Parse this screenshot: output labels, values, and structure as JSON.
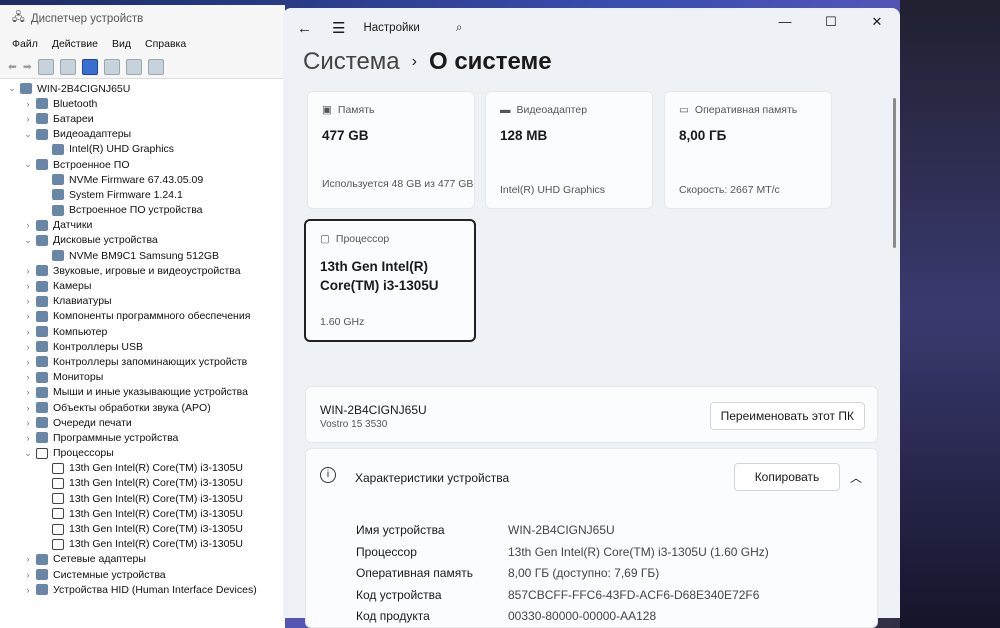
{
  "device_manager": {
    "title": "Диспетчер устройств",
    "menu": [
      "Файл",
      "Действие",
      "Вид",
      "Справка"
    ],
    "tree": [
      {
        "label": "WIN-2B4CIGNJ65U",
        "level": 0,
        "tw": "v"
      },
      {
        "label": "Bluetooth",
        "level": 1,
        "tw": ">"
      },
      {
        "label": "Батареи",
        "level": 1,
        "tw": ">"
      },
      {
        "label": "Видеоадаптеры",
        "level": 1,
        "tw": "v"
      },
      {
        "label": "Intel(R) UHD Graphics",
        "level": 2,
        "tw": ""
      },
      {
        "label": "Встроенное ПО",
        "level": 1,
        "tw": "v"
      },
      {
        "label": "NVMe Firmware 67.43.05.09",
        "level": 2,
        "tw": ""
      },
      {
        "label": "System Firmware 1.24.1",
        "level": 2,
        "tw": ""
      },
      {
        "label": "Встроенное ПО устройства",
        "level": 2,
        "tw": ""
      },
      {
        "label": "Датчики",
        "level": 1,
        "tw": ">"
      },
      {
        "label": "Дисковые устройства",
        "level": 1,
        "tw": "v"
      },
      {
        "label": "NVMe BM9C1 Samsung 512GB",
        "level": 2,
        "tw": ""
      },
      {
        "label": "Звуковые, игровые и видеоустройства",
        "level": 1,
        "tw": ">"
      },
      {
        "label": "Камеры",
        "level": 1,
        "tw": ">"
      },
      {
        "label": "Клавиатуры",
        "level": 1,
        "tw": ">"
      },
      {
        "label": "Компоненты программного обеспечения",
        "level": 1,
        "tw": ">"
      },
      {
        "label": "Компьютер",
        "level": 1,
        "tw": ">"
      },
      {
        "label": "Контроллеры USB",
        "level": 1,
        "tw": ">"
      },
      {
        "label": "Контроллеры запоминающих устройств",
        "level": 1,
        "tw": ">"
      },
      {
        "label": "Мониторы",
        "level": 1,
        "tw": ">"
      },
      {
        "label": "Мыши и иные указывающие устройства",
        "level": 1,
        "tw": ">"
      },
      {
        "label": "Объекты обработки звука (APO)",
        "level": 1,
        "tw": ">"
      },
      {
        "label": "Очереди печати",
        "level": 1,
        "tw": ">"
      },
      {
        "label": "Программные устройства",
        "level": 1,
        "tw": ">"
      },
      {
        "label": "Процессоры",
        "level": 1,
        "tw": "v",
        "cpu": true
      },
      {
        "label": "13th Gen Intel(R) Core(TM) i3-1305U",
        "level": 2,
        "tw": "",
        "cpu": true
      },
      {
        "label": "13th Gen Intel(R) Core(TM) i3-1305U",
        "level": 2,
        "tw": "",
        "cpu": true
      },
      {
        "label": "13th Gen Intel(R) Core(TM) i3-1305U",
        "level": 2,
        "tw": "",
        "cpu": true
      },
      {
        "label": "13th Gen Intel(R) Core(TM) i3-1305U",
        "level": 2,
        "tw": "",
        "cpu": true
      },
      {
        "label": "13th Gen Intel(R) Core(TM) i3-1305U",
        "level": 2,
        "tw": "",
        "cpu": true
      },
      {
        "label": "13th Gen Intel(R) Core(TM) i3-1305U",
        "level": 2,
        "tw": "",
        "cpu": true
      },
      {
        "label": "Сетевые адаптеры",
        "level": 1,
        "tw": ">"
      },
      {
        "label": "Системные устройства",
        "level": 1,
        "tw": ">"
      },
      {
        "label": "Устройства HID (Human Interface Devices)",
        "level": 1,
        "tw": ">"
      }
    ]
  },
  "settings": {
    "app_title": "Настройки",
    "breadcrumb_parent": "Система",
    "breadcrumb_current": "О системе",
    "cards": [
      {
        "label": "Память",
        "value": "477 GB",
        "sub": "Используется 48 GB из 477 GB"
      },
      {
        "label": "Видеоадаптер",
        "value": "128 MB",
        "sub": "Intel(R) UHD Graphics"
      },
      {
        "label": "Оперативная память",
        "value": "8,00 ГБ",
        "sub": "Скорость: 2667 МТ/с"
      },
      {
        "label": "Процессор",
        "value": "13th Gen Intel(R) Core(TM) i3-1305U",
        "sub": "1.60 GHz"
      }
    ],
    "pc_name": "WIN-2B4CIGNJ65U",
    "pc_model": "Vostro 15 3530",
    "rename_button": "Переименовать этот ПК",
    "specs_title": "Характеристики устройства",
    "copy_button": "Копировать",
    "specs": [
      {
        "k": "Имя устройства",
        "v": "WIN-2B4CIGNJ65U"
      },
      {
        "k": "Процессор",
        "v": "13th Gen Intel(R) Core(TM) i3-1305U (1.60 GHz)"
      },
      {
        "k": "Оперативная память",
        "v": "8,00 ГБ (доступно: 7,69 ГБ)"
      },
      {
        "k": "Код устройства",
        "v": "857CBCFF-FFC6-43FD-ACF6-D68E340E72F6"
      },
      {
        "k": "Код продукта",
        "v": "00330-80000-00000-AA128"
      }
    ]
  }
}
